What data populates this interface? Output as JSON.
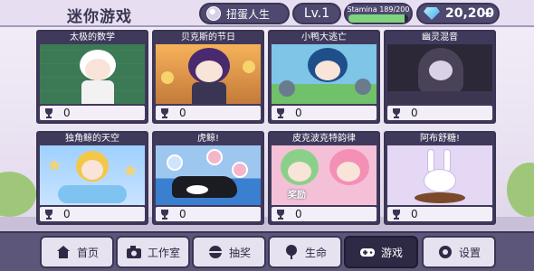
{
  "header": {
    "title": "迷你游戏",
    "game_label": "扭蛋人生",
    "level": "Lv.1",
    "stamina_label": "Stamina 189/200",
    "stamina_fraction": 0.945,
    "gems": "20,200",
    "gems_plus": "+"
  },
  "games": [
    {
      "title": "太极的数学",
      "score": "0"
    },
    {
      "title": "贝克斯的节日",
      "score": "0"
    },
    {
      "title": "小鸭大逃亡",
      "score": "0"
    },
    {
      "title": "幽灵混音",
      "score": "0"
    },
    {
      "title": "独角鲸的天空",
      "score": "0"
    },
    {
      "title": "虎鲸!",
      "score": "0"
    },
    {
      "title": "皮克波克特韵律",
      "score": "0"
    },
    {
      "title": "阿布舒糖!",
      "score": "0"
    }
  ],
  "thumb_text": {
    "reward_label": "奖励"
  },
  "nav": {
    "home": "首页",
    "studio": "工作室",
    "gacha": "抽奖",
    "life": "生命",
    "games": "游戏",
    "settings": "设置"
  },
  "colors": {
    "accent": "#3a3553",
    "stamina": "#7fd37e",
    "active_nav": "#2e2a45"
  }
}
